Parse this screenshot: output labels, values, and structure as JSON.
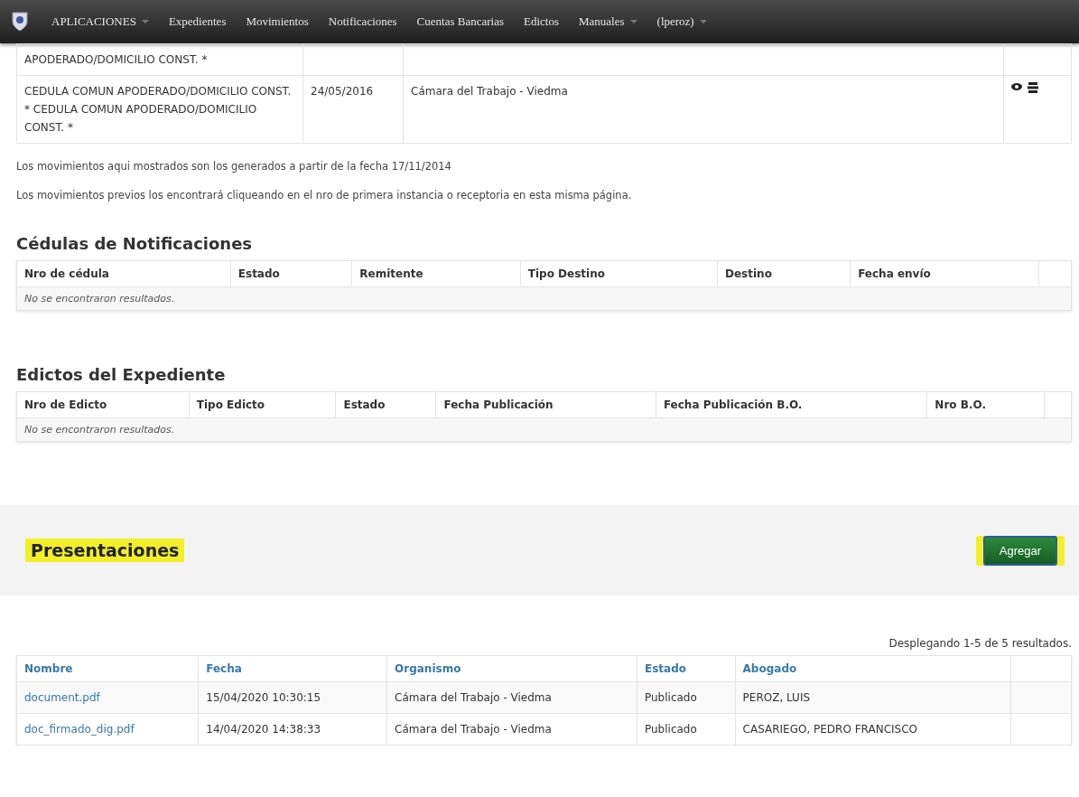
{
  "navbar": {
    "items": [
      {
        "label": "APLICACIONES",
        "dropdown": true
      },
      {
        "label": "Expedientes",
        "dropdown": false
      },
      {
        "label": "Movimientos",
        "dropdown": false
      },
      {
        "label": "Notificaciones",
        "dropdown": false
      },
      {
        "label": "Cuentas Bancarias",
        "dropdown": false
      },
      {
        "label": "Edictos",
        "dropdown": false
      },
      {
        "label": "Manuales",
        "dropdown": true
      },
      {
        "label": "(lperoz)",
        "dropdown": true
      }
    ]
  },
  "movimientos": {
    "rows": [
      {
        "descripcion": "APODERADO/DOMICILIO CONST. *",
        "fecha": "",
        "organismo": "",
        "actions": false
      },
      {
        "descripcion": "CEDULA COMUN APODERADO/DOMICILIO CONST. * CEDULA COMUN APODERADO/DOMICILIO CONST. *",
        "fecha": "24/05/2016",
        "organismo": "Cámara del Trabajo - Viedma",
        "actions": true
      }
    ],
    "notes": [
      "Los movimientos aqui mostrados son los generados a partir de la fecha 17/11/2014",
      "Los movimientos previos los encontrará cliqueando en el nro de primera instancia o receptoria en esta misma página."
    ]
  },
  "cedulas": {
    "title": "Cédulas de Notificaciones",
    "columns": [
      "Nro de cédula",
      "Estado",
      "Remitente",
      "Tipo Destino",
      "Destino",
      "Fecha envío"
    ],
    "empty": "No se encontraron resultados."
  },
  "edictos": {
    "title": "Edictos del Expediente",
    "columns": [
      "Nro de Edicto",
      "Tipo Edicto",
      "Estado",
      "Fecha Publicación",
      "Fecha Publicación B.O.",
      "Nro B.O."
    ],
    "empty": "No se encontraron resultados."
  },
  "presentaciones": {
    "title": "Presentaciones",
    "add_button": "Agregar",
    "summary": "Desplegando 1-5 de 5 resultados.",
    "columns": [
      "Nombre",
      "Fecha",
      "Organismo",
      "Estado",
      "Abogado"
    ],
    "rows": [
      {
        "nombre": "document.pdf",
        "fecha": "15/04/2020 10:30:15",
        "organismo": "Cámara del Trabajo - Viedma",
        "estado": "Publicado",
        "abogado": "PEROZ, LUIS"
      },
      {
        "nombre": "doc_firmado_dig.pdf",
        "fecha": "14/04/2020 14:38:33",
        "organismo": "Cámara del Trabajo - Viedma",
        "estado": "Publicado",
        "abogado": "CASARIEGO, PEDRO FRANCISCO"
      }
    ]
  }
}
